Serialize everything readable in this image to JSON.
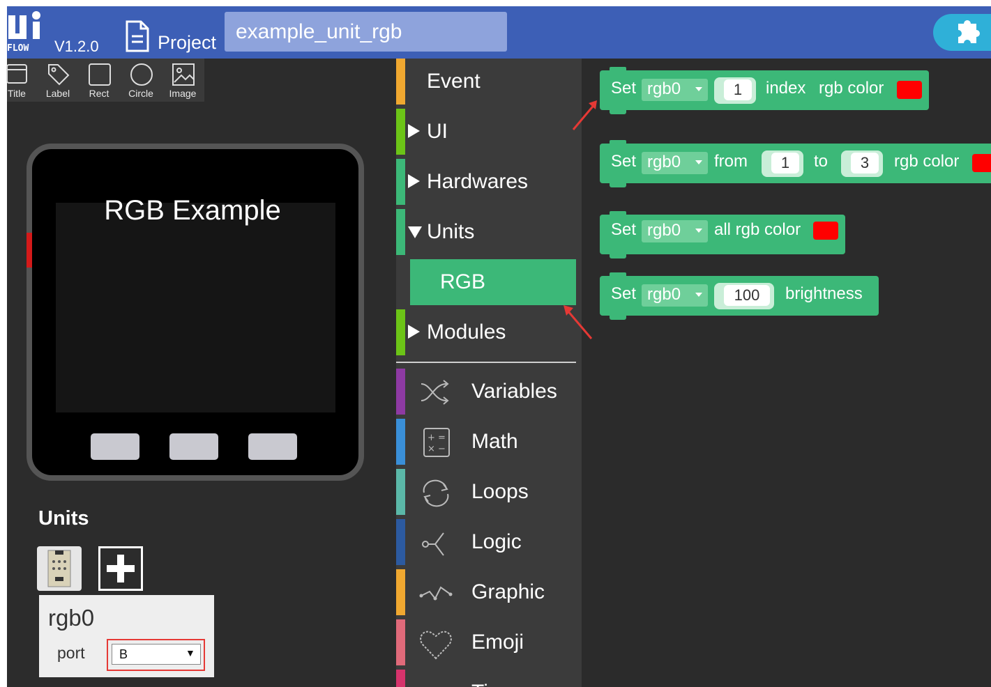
{
  "app": {
    "logo_text": "Ui FLOW",
    "version": "V1.2.0",
    "project_label": "Project",
    "project_name": "example_unit_rgb",
    "brand_color": "#3d5fb6"
  },
  "tools": [
    {
      "label": "Title",
      "icon": "title-icon"
    },
    {
      "label": "Label",
      "icon": "label-tag-icon"
    },
    {
      "label": "Rect",
      "icon": "rect-icon"
    },
    {
      "label": "Circle",
      "icon": "circle-icon"
    },
    {
      "label": "Image",
      "icon": "image-icon"
    }
  ],
  "device": {
    "screen_title": "RGB Example"
  },
  "units_panel": {
    "heading": "Units",
    "unit_name": "rgb0",
    "port_label": "port",
    "port_value": "B"
  },
  "categories": {
    "event": "Event",
    "ui": "UI",
    "hardwares": "Hardwares",
    "units": "Units",
    "rgb": "RGB",
    "modules": "Modules",
    "variables": "Variables",
    "math": "Math",
    "loops": "Loops",
    "logic": "Logic",
    "graphic": "Graphic",
    "emoji": "Emoji",
    "timer": "Ti"
  },
  "category_colors": {
    "event": "#f0a830",
    "ui": "#6cc417",
    "hardwares": "#3cb878",
    "units": "#3cb878",
    "modules": "#6cc417",
    "variables": "#8e3aa3",
    "math": "#3a8fd8",
    "loops": "#5bb8a8",
    "logic": "#2c5aa0",
    "graphic": "#f0a830",
    "emoji": "#e06a7a",
    "timer": "#d6336c"
  },
  "blocks": {
    "b1": {
      "set": "Set",
      "var": "rgb0",
      "index_val": "1",
      "t1": "index",
      "t2": "rgb color",
      "color": "#ff0000"
    },
    "b2": {
      "set": "Set",
      "var": "rgb0",
      "from": "from",
      "from_val": "1",
      "to": "to",
      "to_val": "3",
      "t2": "rgb color",
      "color": "#ff0000"
    },
    "b3": {
      "set": "Set",
      "var": "rgb0",
      "t1": "all rgb color",
      "color": "#ff0000"
    },
    "b4": {
      "set": "Set",
      "var": "rgb0",
      "val": "100",
      "t1": "brightness"
    }
  }
}
